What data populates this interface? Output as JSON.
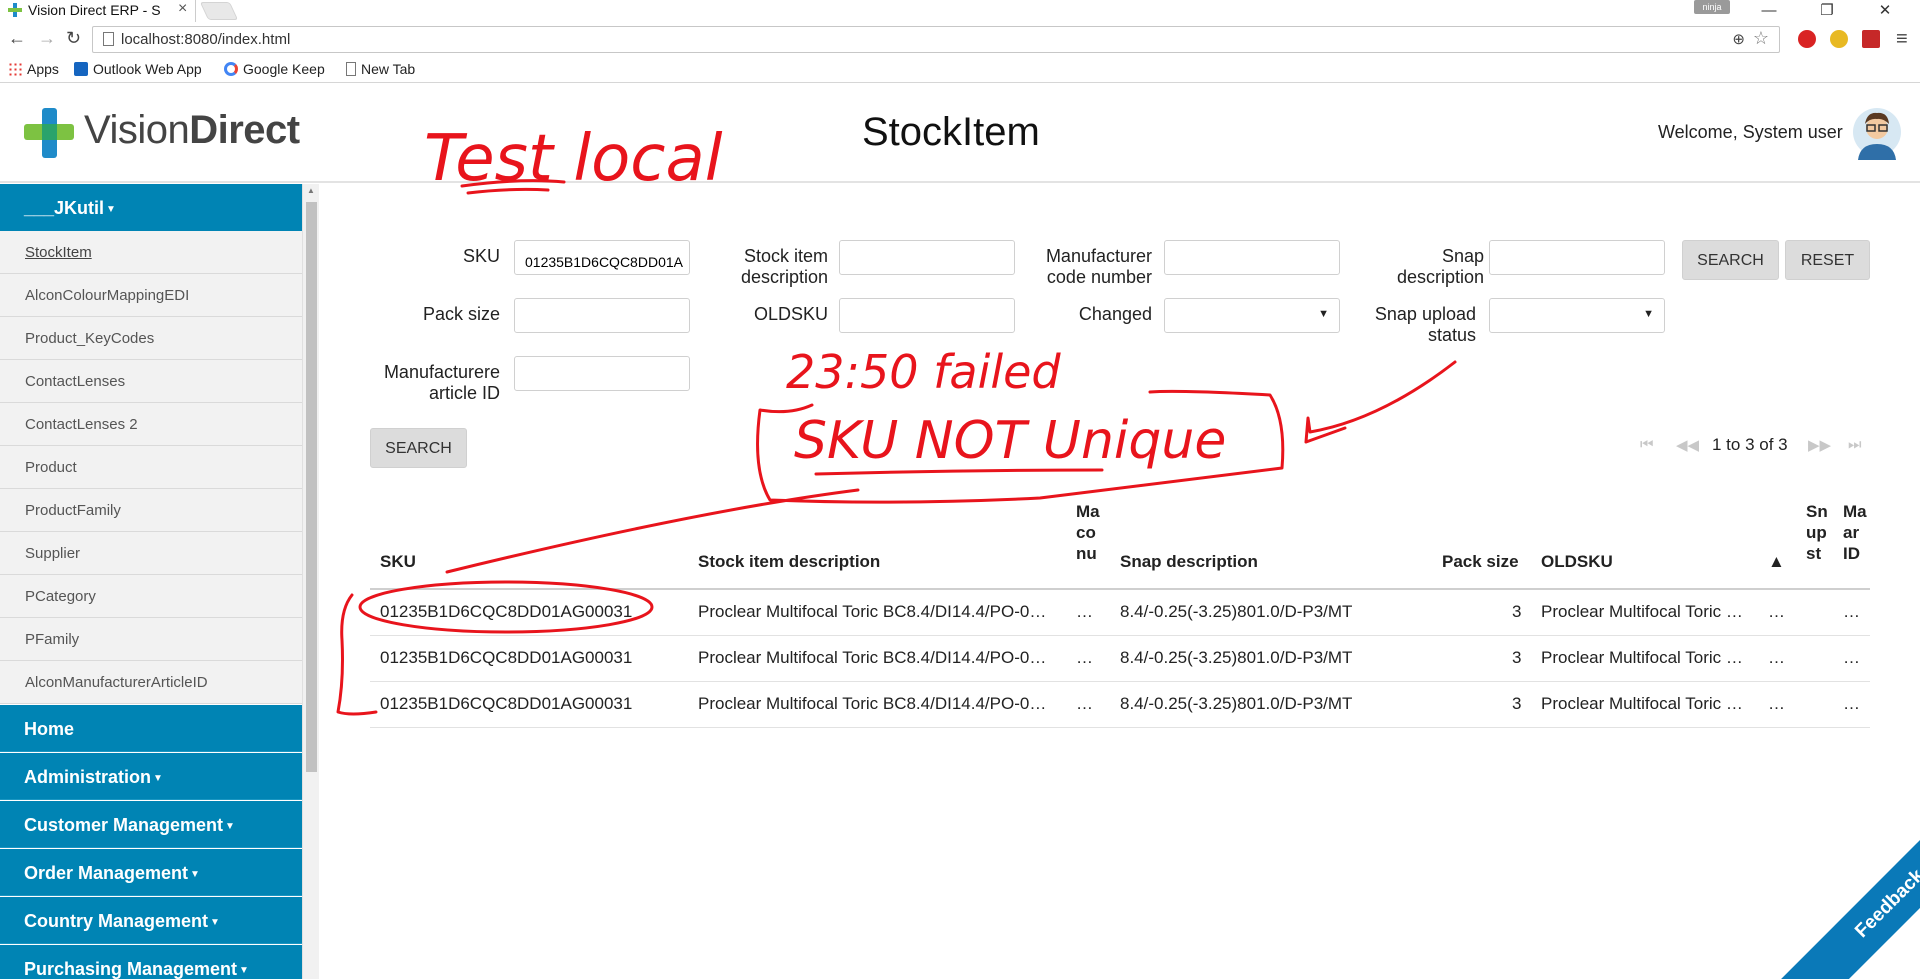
{
  "browser": {
    "tab_title": "Vision Direct ERP - S",
    "tab_close": "×",
    "ninja_label": "ninja",
    "window_controls": [
      "—",
      "❐",
      "✕"
    ],
    "url": "localhost:8080/index.html",
    "bookmarks": [
      {
        "label": "Apps",
        "icon": "apps-grid-icon"
      },
      {
        "label": "Outlook Web App",
        "icon": "outlook-icon"
      },
      {
        "label": "Google Keep",
        "icon": "google-icon"
      },
      {
        "label": "New Tab",
        "icon": "page-icon"
      }
    ]
  },
  "header": {
    "logo_light": "Vision",
    "logo_bold": "Direct",
    "page_title": "StockItem",
    "welcome": "Welcome, System user"
  },
  "sidebar": {
    "top_group": "___JKutil",
    "sub_items": [
      "StockItem",
      "AlconColourMappingEDI",
      "Product_KeyCodes",
      "ContactLenses",
      "ContactLenses 2",
      "Product",
      "ProductFamily",
      "Supplier",
      "PCategory",
      "PFamily",
      "AlconManufacturerArticleID"
    ],
    "sections": [
      "Home",
      "Administration",
      "Customer Management",
      "Order Management",
      "Country Management",
      "Purchasing Management"
    ]
  },
  "filters": {
    "sku_label": "SKU",
    "sku_value": "01235B1D6CQC8DD01A",
    "stock_desc_label_1": "Stock item",
    "stock_desc_label_2": "description",
    "stock_desc_value": "",
    "mfr_code_label_1": "Manufacturer",
    "mfr_code_label_2": "code number",
    "mfr_code_value": "",
    "snap_desc_label_1": "Snap",
    "snap_desc_label_2": "description",
    "snap_desc_value": "",
    "pack_size_label": "Pack size",
    "pack_size_value": "",
    "oldsku_label": "OLDSKU",
    "oldsku_value": "",
    "changed_label": "Changed",
    "changed_value": "",
    "snap_upload_label_1": "Snap upload",
    "snap_upload_label_2": "status",
    "snap_upload_value": "",
    "mfr_article_label_1": "Manufacturere",
    "mfr_article_label_2": "article ID",
    "mfr_article_value": "",
    "search_button": "SEARCH",
    "reset_button": "RESET",
    "bottom_search_button": "SEARCH"
  },
  "pager": {
    "text": "1 to 3 of 3",
    "icons": [
      "first-page-icon",
      "prev-page-icon",
      "next-page-icon",
      "last-page-icon"
    ]
  },
  "table": {
    "headers": {
      "sku": "SKU",
      "stock_desc": "Stock item description",
      "mfr_code": [
        "Ma",
        "co",
        "nu"
      ],
      "snap_desc": "Snap description",
      "pack_size": "Pack size",
      "oldsku": "OLDSKU",
      "sort_arrow": "▲",
      "snap_upload": [
        "Sn",
        "up",
        "st"
      ],
      "mfr_article": [
        "Ma",
        "ar",
        "ID"
      ]
    },
    "rows": [
      {
        "sku": "01235B1D6CQC8DD01AG00031",
        "stock_desc": "Proclear Multifocal Toric BC8.4/DI14.4/PO-0…",
        "mfr_code": "…",
        "snap_desc": "8.4/-0.25(-3.25)801.0/D-P3/MT",
        "pack_size": "3",
        "oldsku": "Proclear Multifocal Toric …",
        "changed": "…",
        "mfr_article": "…"
      },
      {
        "sku": "01235B1D6CQC8DD01AG00031",
        "stock_desc": "Proclear Multifocal Toric BC8.4/DI14.4/PO-0…",
        "mfr_code": "…",
        "snap_desc": "8.4/-0.25(-3.25)801.0/D-P3/MT",
        "pack_size": "3",
        "oldsku": "Proclear Multifocal Toric …",
        "changed": "…",
        "mfr_article": "…"
      },
      {
        "sku": "01235B1D6CQC8DD01AG00031",
        "stock_desc": "Proclear Multifocal Toric BC8.4/DI14.4/PO-0…",
        "mfr_code": "…",
        "snap_desc": "8.4/-0.25(-3.25)801.0/D-P3/MT",
        "pack_size": "3",
        "oldsku": "Proclear Multifocal Toric …",
        "changed": "…",
        "mfr_article": "…"
      }
    ]
  },
  "annotations": {
    "note_1": "Test local",
    "note_2": "23:50 failed",
    "note_3": "SKU NOT Unique",
    "color": "#e8141c"
  },
  "feedback": "Feedback",
  "colors": {
    "sidebar_blue": "#0084b4",
    "logo_green": "#7dc242",
    "logo_blue": "#1f8bc9"
  }
}
